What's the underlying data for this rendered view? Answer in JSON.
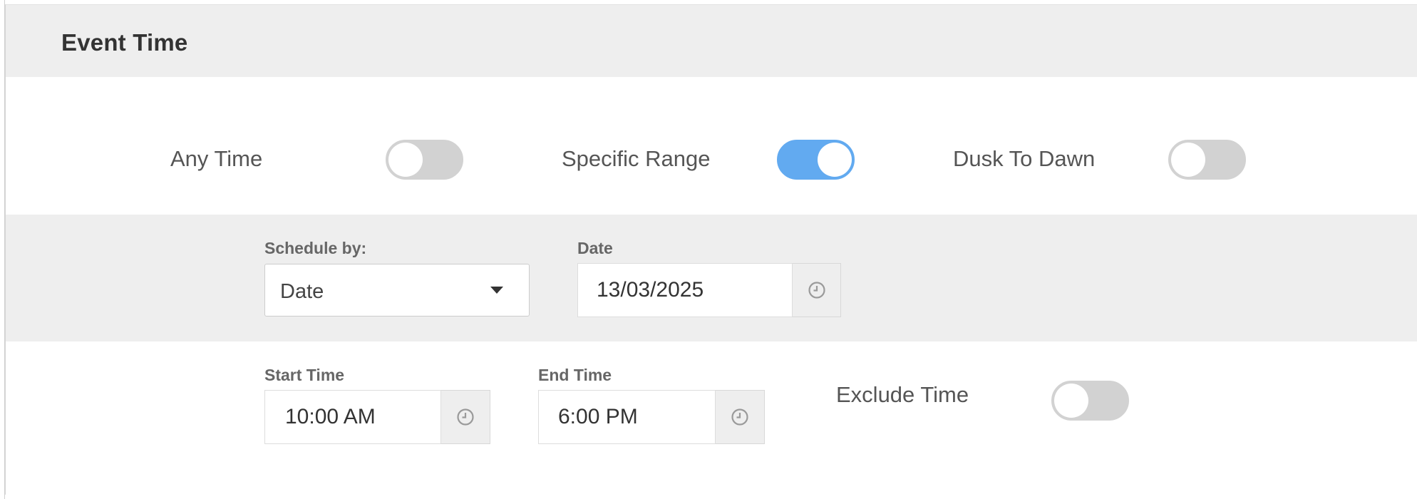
{
  "header": {
    "title": "Event Time"
  },
  "time_mode": {
    "options": [
      {
        "label": "Any Time",
        "enabled": false
      },
      {
        "label": "Specific Range",
        "enabled": true
      },
      {
        "label": "Dusk To Dawn",
        "enabled": false
      }
    ]
  },
  "schedule": {
    "schedule_by_label": "Schedule by:",
    "schedule_by_value": "Date",
    "date_label": "Date",
    "date_value": "13/03/2025"
  },
  "time_range": {
    "start_label": "Start Time",
    "start_value": "10:00 AM",
    "end_label": "End Time",
    "end_value": "6:00 PM",
    "exclude_label": "Exclude Time",
    "exclude_enabled": false
  },
  "icons": {
    "dropdown": "caret-down-icon",
    "time_picker": "clock-icon"
  },
  "colors": {
    "toggle_on": "#62aaf0",
    "toggle_off": "#d2d2d2",
    "band_background": "#eeeeee"
  }
}
